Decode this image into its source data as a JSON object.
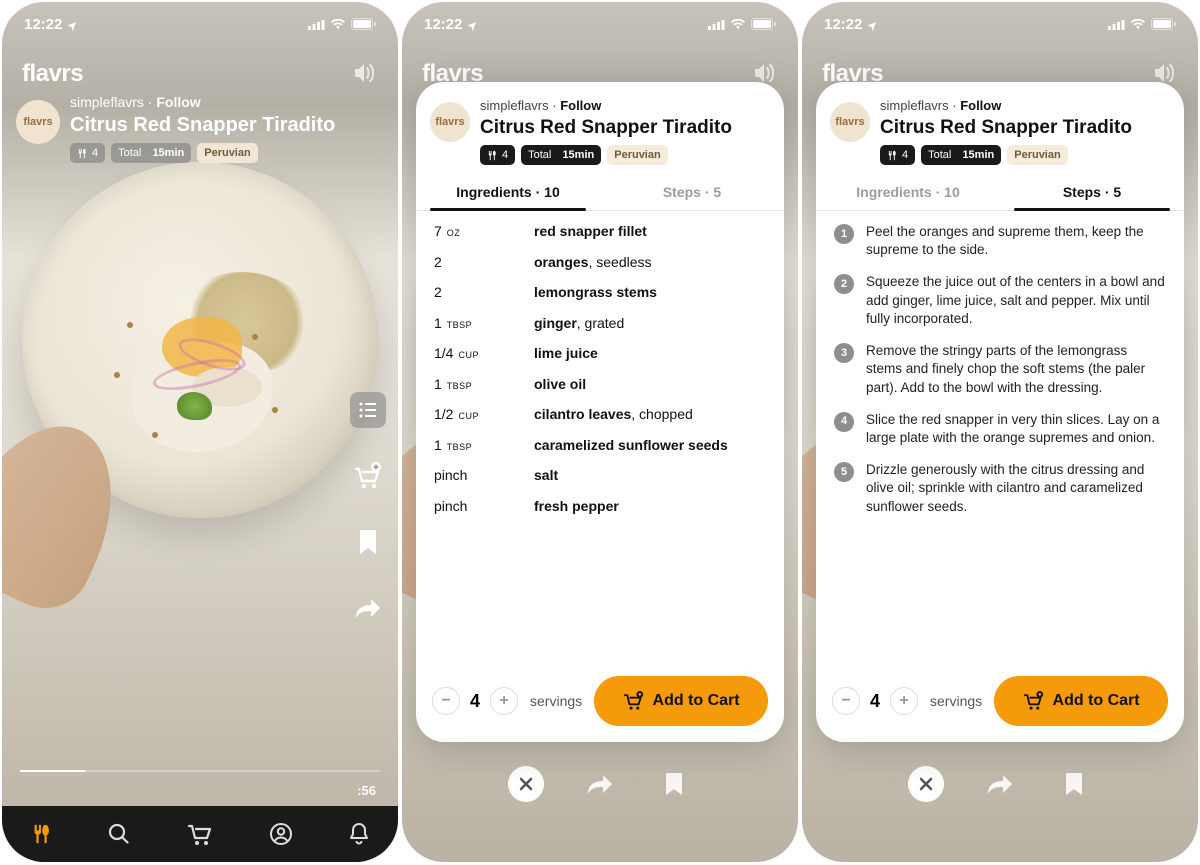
{
  "status": {
    "time": "12:22"
  },
  "brand": "flavrs",
  "avatar_text": "flavrs",
  "author": "simpleflavrs",
  "follow": "Follow",
  "title": "Citrus Red Snapper Tiradito",
  "badges": {
    "servings": "4",
    "total_label": "Total",
    "total_time": "15min",
    "cuisine": "Peruvian"
  },
  "video": {
    "duration": ":56"
  },
  "tabs": {
    "ingredients_label": "Ingredients",
    "ingredients_count": "10",
    "steps_label": "Steps",
    "steps_count": "5"
  },
  "ingredients": [
    {
      "qty": "7",
      "unit": "oz",
      "name": "red snapper fillet",
      "note": ""
    },
    {
      "qty": "2",
      "unit": "",
      "name": "oranges",
      "note": ", seedless"
    },
    {
      "qty": "2",
      "unit": "",
      "name": "lemongrass stems",
      "note": ""
    },
    {
      "qty": "1",
      "unit": "TBSP",
      "name": "ginger",
      "note": ", grated"
    },
    {
      "qty": "1/4",
      "unit": "CUP",
      "name": "lime juice",
      "note": ""
    },
    {
      "qty": "1",
      "unit": "TBSP",
      "name": "olive oil",
      "note": ""
    },
    {
      "qty": "1/2",
      "unit": "CUP",
      "name": "cilantro leaves",
      "note": ", chopped"
    },
    {
      "qty": "1",
      "unit": "TBSP",
      "name": "caramelized sunflower seeds",
      "note": ""
    },
    {
      "qty": "pinch",
      "unit": "",
      "name": "salt",
      "note": ""
    },
    {
      "qty": "pinch",
      "unit": "",
      "name": "fresh pepper",
      "note": ""
    }
  ],
  "steps": [
    "Peel the oranges and supreme them, keep the supreme to the side.",
    "Squeeze the juice out of the centers in a bowl and add ginger, lime juice, salt and pepper. Mix until fully incorporated.",
    "Remove the stringy parts of the lemongrass stems and finely chop the soft stems (the paler part). Add to the bowl with the dressing.",
    "Slice the red snapper in very thin slices. Lay on a large plate with the orange supremes and onion.",
    "Drizzle generously with the citrus dressing and olive oil; sprinkle with cilantro and caramelized sunflower seeds."
  ],
  "footer": {
    "servings_value": "4",
    "servings_label": "servings",
    "add_to_cart": "Add to Cart"
  }
}
